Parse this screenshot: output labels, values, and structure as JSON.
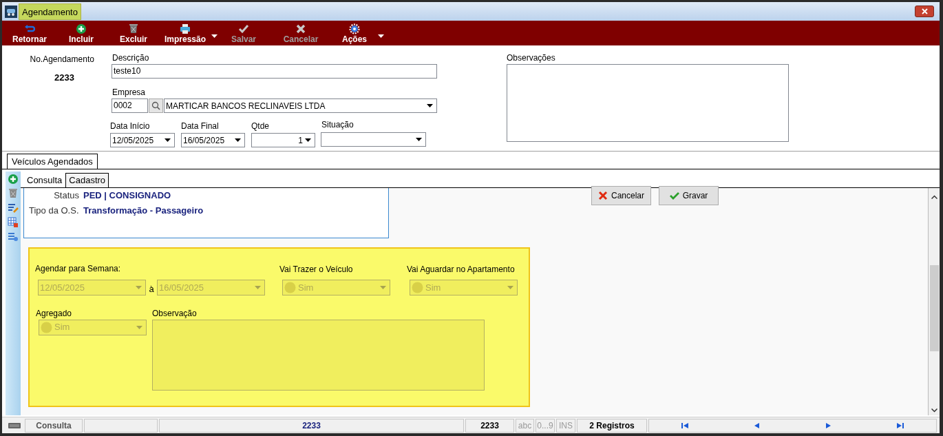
{
  "window": {
    "title": "Agendamento"
  },
  "toolbar": [
    {
      "kind": "return",
      "label": "Retornar",
      "disabled": false,
      "has_menu": false
    },
    {
      "kind": "add",
      "label": "Incluir",
      "disabled": false,
      "has_menu": false
    },
    {
      "kind": "delete",
      "label": "Excluir",
      "disabled": false,
      "has_menu": false
    },
    {
      "kind": "print",
      "label": "Impressão",
      "disabled": false,
      "has_menu": true
    },
    {
      "kind": "save",
      "label": "Salvar",
      "disabled": true,
      "has_menu": false
    },
    {
      "kind": "cancel",
      "label": "Cancelar",
      "disabled": true,
      "has_menu": false
    },
    {
      "kind": "gear",
      "label": "Ações",
      "disabled": false,
      "has_menu": true
    }
  ],
  "header": {
    "number_label": "No.Agendamento",
    "number": "2233",
    "descricao": {
      "label": "Descrição",
      "value": "teste10"
    },
    "empresa": {
      "label": "Empresa",
      "code": "0002",
      "name": "MARTICAR BANCOS RECLINAVEIS LTDA"
    },
    "data_inicio": {
      "label": "Data Início",
      "value": "12/05/2025"
    },
    "data_final": {
      "label": "Data Final",
      "value": "16/05/2025"
    },
    "qtde": {
      "label": "Qtde",
      "value": "1"
    },
    "situacao": {
      "label": "Situação"
    },
    "observacoes": {
      "label": "Observações"
    }
  },
  "tabs": [
    {
      "label": "Veículos Agendados",
      "selected": true
    }
  ],
  "subtabs": [
    {
      "label": "Consulta",
      "selected": false
    },
    {
      "label": "Cadastro",
      "selected": true
    }
  ],
  "info": [
    {
      "label": "Status",
      "value": "PED | CONSIGNADO"
    },
    {
      "label": "Tipo da O.S.",
      "value": "Transformação - Passageiro"
    }
  ],
  "actions": [
    {
      "kind": "cancel",
      "label": "Cancelar"
    },
    {
      "kind": "save",
      "label": "Gravar"
    }
  ],
  "form": {
    "disabled": true,
    "semana_label": "Agendar para Semana:",
    "semana_inicio": "12/05/2025",
    "semana_sep": "à",
    "semana_fim": "16/05/2025",
    "trazer": {
      "label": "Vai Trazer o Veículo",
      "value": "Sim"
    },
    "aguardar": {
      "label": "Vai Aguardar no Apartamento",
      "value": "Sim"
    },
    "agregado": {
      "label": "Agregado",
      "value": "Sim"
    },
    "observacao": {
      "label": "Observação"
    }
  },
  "status_bar": {
    "mode": "Consulta",
    "record": "2233",
    "id": "2233",
    "flags": [
      {
        "label": "abc",
        "on": false
      },
      {
        "label": "0...9",
        "on": false
      },
      {
        "label": "INS",
        "on": false
      }
    ],
    "count": "2 Registros"
  }
}
